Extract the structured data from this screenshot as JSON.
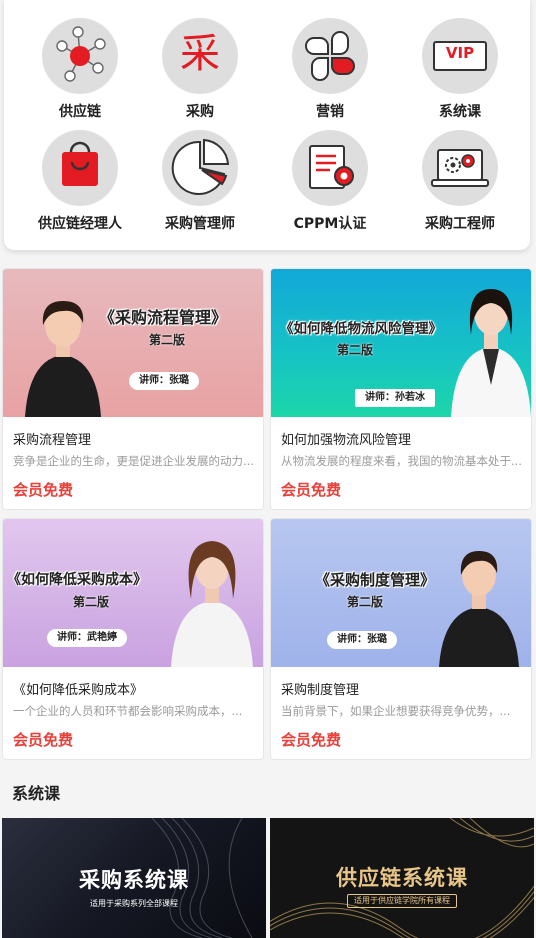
{
  "categories": [
    {
      "label": "供应链",
      "icon": "network-icon"
    },
    {
      "label": "采购",
      "icon": "cai-char-icon",
      "glyph": "采"
    },
    {
      "label": "营销",
      "icon": "clover-grid-icon"
    },
    {
      "label": "系统课",
      "icon": "vip-icon",
      "glyph": "VIP"
    },
    {
      "label": "供应链经理人",
      "icon": "shopping-bag-icon"
    },
    {
      "label": "采购管理师",
      "icon": "pie-chart-icon"
    },
    {
      "label": "CPPM认证",
      "icon": "certificate-icon"
    },
    {
      "label": "采购工程师",
      "icon": "laptop-gears-icon"
    }
  ],
  "courses": [
    {
      "banner_title": "《采购流程管理》",
      "edition": "第二版",
      "lecturer": "讲师：张璐",
      "name": "采购流程管理",
      "desc": "竞争是企业的生命，更是促进企业发展的动力...",
      "price": "会员免费"
    },
    {
      "banner_title": "《如何降低物流风险管理》",
      "edition": "第二版",
      "lecturer": "讲师：孙若冰",
      "name": "如何加强物流风险管理",
      "desc": "从物流发展的程度来看，我国的物流基本处于...",
      "price": "会员免费"
    },
    {
      "banner_title": "《如何降低采购成本》",
      "edition": "第二版",
      "lecturer": "讲师：武艳婷",
      "name": "《如何降低采购成本》",
      "desc": "一个企业的人员和环节都会影响采购成本，...",
      "price": "会员免费"
    },
    {
      "banner_title": "《采购制度管理》",
      "edition": "第二版",
      "lecturer": "讲师：张璐",
      "name": "采购制度管理",
      "desc": "当前背景下，如果企业想要获得竞争优势，...",
      "price": "会员免费"
    }
  ],
  "section": {
    "title": "系统课"
  },
  "system_courses": [
    {
      "title": "采购系统课",
      "subtitle": "适用于采购系列全部课程"
    },
    {
      "title": "供应链系统课",
      "subtitle": "适用于供应链学院所有课程"
    }
  ],
  "colors": {
    "accent": "#e8403a",
    "icon_red": "#e31c23"
  }
}
